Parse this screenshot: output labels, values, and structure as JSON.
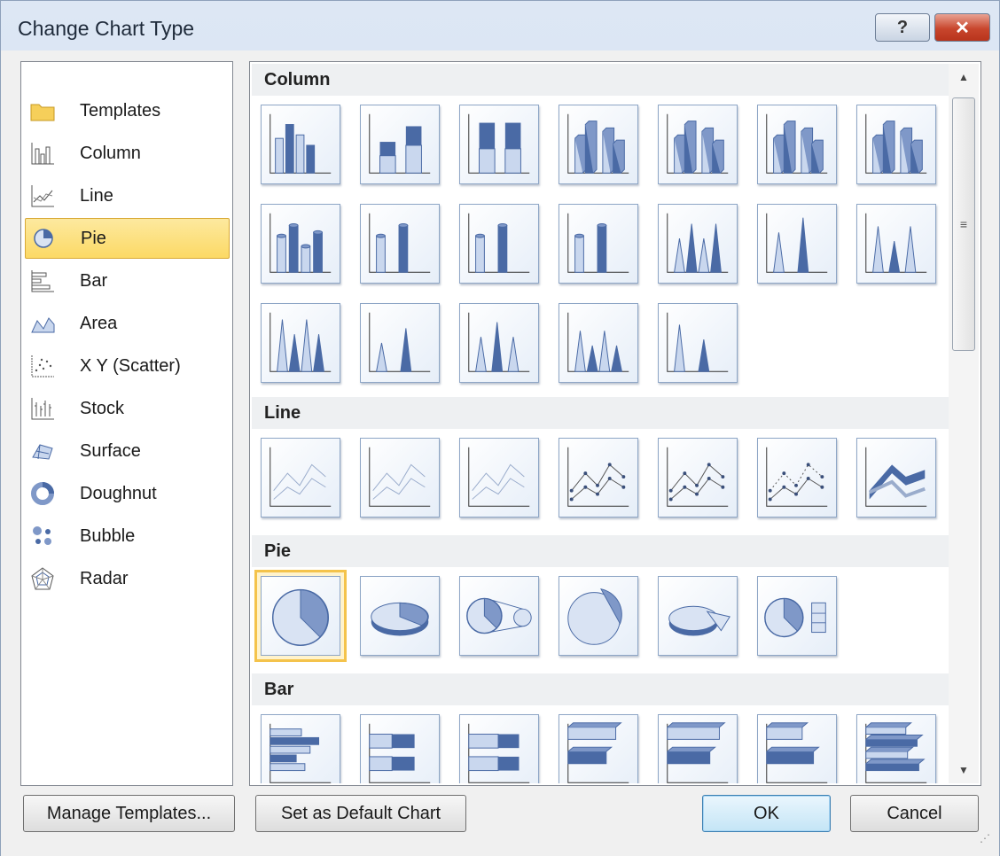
{
  "dialog": {
    "title": "Change Chart Type",
    "help_glyph": "?",
    "close_glyph": "✕"
  },
  "categories": [
    {
      "label": "Templates",
      "icon": "folder-icon"
    },
    {
      "label": "Column",
      "icon": "column-chart-icon"
    },
    {
      "label": "Line",
      "icon": "line-chart-icon"
    },
    {
      "label": "Pie",
      "icon": "pie-chart-icon",
      "selected": true
    },
    {
      "label": "Bar",
      "icon": "bar-chart-icon"
    },
    {
      "label": "Area",
      "icon": "area-chart-icon"
    },
    {
      "label": "X Y (Scatter)",
      "icon": "scatter-chart-icon"
    },
    {
      "label": "Stock",
      "icon": "stock-chart-icon"
    },
    {
      "label": "Surface",
      "icon": "surface-chart-icon"
    },
    {
      "label": "Doughnut",
      "icon": "doughnut-chart-icon"
    },
    {
      "label": "Bubble",
      "icon": "bubble-chart-icon"
    },
    {
      "label": "Radar",
      "icon": "radar-chart-icon"
    }
  ],
  "sections": [
    {
      "title": "Column",
      "kind": "column",
      "count": 19
    },
    {
      "title": "Line",
      "kind": "line",
      "count": 7
    },
    {
      "title": "Pie",
      "kind": "pie",
      "count": 6,
      "selected_index": 0
    },
    {
      "title": "Bar",
      "kind": "bar",
      "count": 7
    }
  ],
  "buttons": {
    "manage_templates": "Manage Templates...",
    "set_default": "Set as Default Chart",
    "ok": "OK",
    "cancel": "Cancel"
  },
  "colors": {
    "accent_blue": "#4a6aa5",
    "light_blue": "#c9d7ee",
    "selection_yellow": "#fcd965"
  }
}
